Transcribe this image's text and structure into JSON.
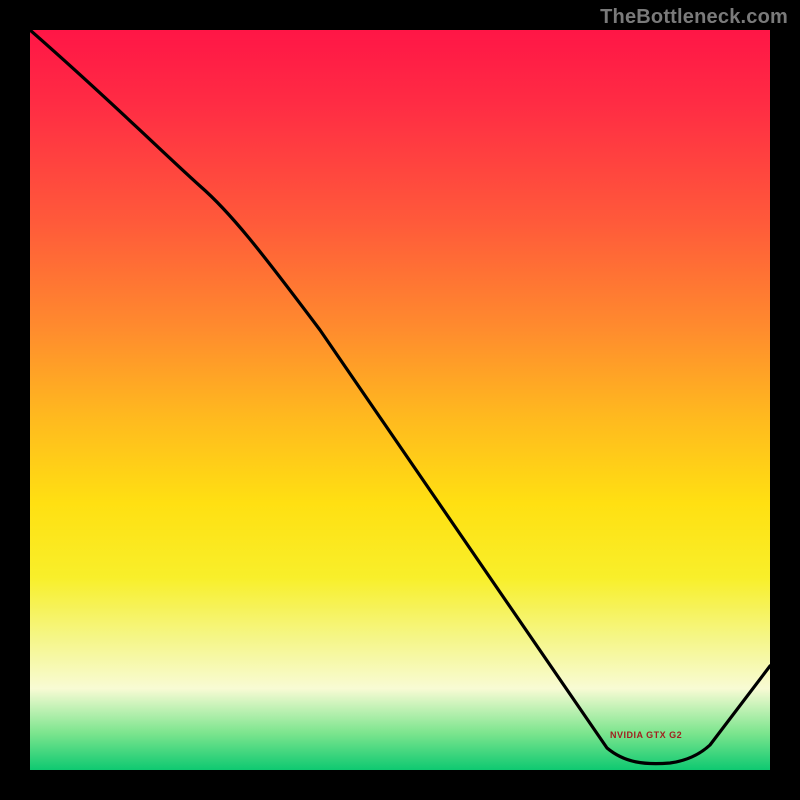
{
  "source_watermark": "TheBottleneck.com",
  "annotation_label": "NVIDIA GTX  G2",
  "colors": {
    "frame": "#000000",
    "curve": "#000000",
    "watermark": "#7a7a7a",
    "annotation": "#a02020",
    "gradient_stops": [
      "#ff1646",
      "#ff2c44",
      "#ff5a3a",
      "#ff8a2e",
      "#ffb81f",
      "#ffe012",
      "#f8ef2a",
      "#f5f686",
      "#f8fbd4",
      "#7ce58e",
      "#0ec971"
    ]
  },
  "chart_data": {
    "type": "line",
    "title": "",
    "xlabel": "",
    "ylabel": "",
    "xlim": [
      0,
      100
    ],
    "ylim": [
      0,
      100
    ],
    "grid": false,
    "legend": false,
    "note": "No axis ticks or numeric labels are drawn; values are normalized 0-100 read from plot proportions.",
    "series": [
      {
        "name": "bottleneck-curve",
        "x": [
          0,
          23,
          78,
          85,
          90,
          100
        ],
        "values": [
          100,
          79,
          3,
          2,
          3,
          14
        ],
        "interp_notes": "slight knee at x≈23; broad flat minimum (~2) around x≈82–90; rises to ~14 at x=100"
      }
    ],
    "annotations": [
      {
        "text_ref": "annotation_label",
        "x": 84,
        "y": 4
      }
    ]
  }
}
